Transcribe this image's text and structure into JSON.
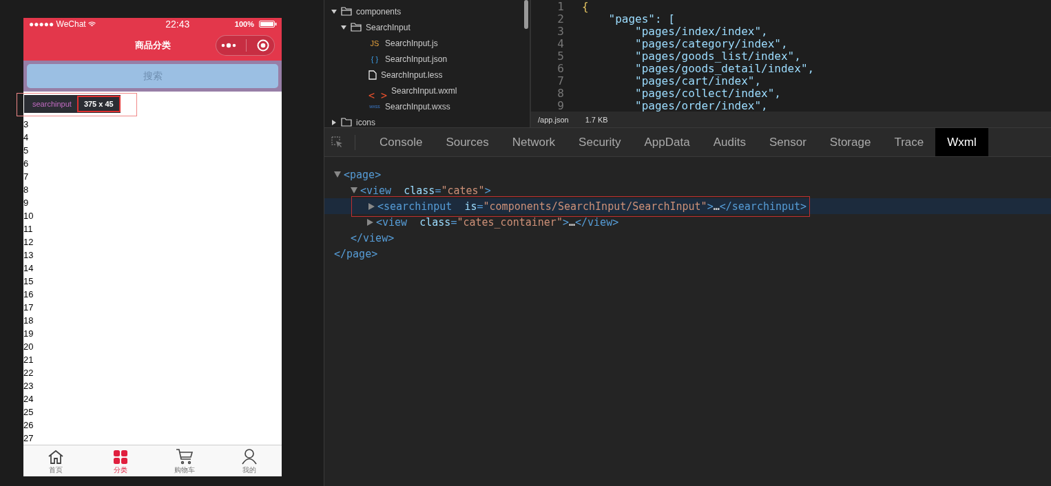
{
  "phone": {
    "status_bar": {
      "carrier": "●●●●● WeChat",
      "time": "22:43",
      "battery": "100%"
    },
    "nav_title": "商品分类",
    "search": {
      "placeholder": "搜索"
    },
    "inspect_tooltip": {
      "tag": "searchinput",
      "size": "375 x 45"
    },
    "list_items": [
      "3",
      "4",
      "5",
      "6",
      "7",
      "8",
      "9",
      "10",
      "11",
      "12",
      "13",
      "14",
      "15",
      "16",
      "17",
      "18",
      "19",
      "20",
      "21",
      "22",
      "23",
      "24",
      "25",
      "26",
      "27"
    ],
    "tab_bar": [
      {
        "kind": "home",
        "label": "首页",
        "selected": false
      },
      {
        "kind": "grid",
        "label": "分类",
        "selected": true
      },
      {
        "kind": "cart",
        "label": "购物车",
        "selected": false
      },
      {
        "kind": "person",
        "label": "我的",
        "selected": false
      }
    ]
  },
  "file_tree": [
    {
      "kind": "folder",
      "name": "components",
      "expanded": true,
      "children": [
        {
          "kind": "folder",
          "name": "SearchInput",
          "expanded": true,
          "children": [
            {
              "kind": "js",
              "badge": "JS",
              "name": "SearchInput.js"
            },
            {
              "kind": "json",
              "badge": "{ }",
              "name": "SearchInput.json"
            },
            {
              "kind": "file",
              "name": "SearchInput.less"
            },
            {
              "kind": "wxml",
              "badge": "< >",
              "name": "SearchInput.wxml"
            },
            {
              "kind": "wxss",
              "badge": "wxss",
              "name": "SearchInput.wxss"
            }
          ]
        }
      ]
    },
    {
      "kind": "folder",
      "name": "icons",
      "expanded": false
    }
  ],
  "editor": {
    "lines": [
      {
        "number": "1",
        "code": "{"
      },
      {
        "number": "2",
        "code": "    \"pages\": ["
      },
      {
        "number": "3",
        "code": "        \"pages/index/index\","
      },
      {
        "number": "4",
        "code": "        \"pages/category/index\","
      },
      {
        "number": "5",
        "code": "        \"pages/goods_list/index\","
      },
      {
        "number": "6",
        "code": "        \"pages/goods_detail/index\","
      },
      {
        "number": "7",
        "code": "        \"pages/cart/index\","
      },
      {
        "number": "8",
        "code": "        \"pages/collect/index\","
      },
      {
        "number": "9",
        "code": "        \"pages/order/index\","
      }
    ],
    "status": {
      "path": "/app.json",
      "size": "1.7 KB"
    }
  },
  "devtools": {
    "tabs": [
      {
        "label": "Console",
        "selected": false
      },
      {
        "label": "Sources",
        "selected": false
      },
      {
        "label": "Network",
        "selected": false
      },
      {
        "label": "Security",
        "selected": false
      },
      {
        "label": "AppData",
        "selected": false
      },
      {
        "label": "Audits",
        "selected": false
      },
      {
        "label": "Sensor",
        "selected": false
      },
      {
        "label": "Storage",
        "selected": false
      },
      {
        "label": "Trace",
        "selected": false
      },
      {
        "label": "Wxml",
        "selected": true
      }
    ],
    "wxml_tree": [
      {
        "expanded": true,
        "selected": false,
        "open": [
          {
            "kind": "tag",
            "text": "<page>"
          }
        ],
        "close": [
          {
            "kind": "tag",
            "text": "</page>"
          }
        ],
        "children": [
          {
            "expanded": true,
            "selected": false,
            "open": [
              {
                "kind": "tag",
                "text": "<view"
              },
              {
                "kind": "attr",
                "text": "  class"
              },
              {
                "kind": "tag",
                "text": "="
              },
              {
                "kind": "value",
                "text": "\"cates\""
              },
              {
                "kind": "tag",
                "text": ">"
              }
            ],
            "close": [
              {
                "kind": "tag",
                "text": "</view>"
              }
            ],
            "children": [
              {
                "expanded": false,
                "selected": true,
                "open": [
                  {
                    "kind": "tag",
                    "text": "<searchinput"
                  },
                  {
                    "kind": "attr",
                    "text": "  is"
                  },
                  {
                    "kind": "tag",
                    "text": "="
                  },
                  {
                    "kind": "value",
                    "text": "\"components/SearchInput/SearchInput\""
                  },
                  {
                    "kind": "tag",
                    "text": ">"
                  },
                  {
                    "kind": "dots",
                    "text": "…"
                  },
                  {
                    "kind": "tag",
                    "text": "</searchinput>"
                  }
                ]
              },
              {
                "expanded": false,
                "selected": false,
                "open": [
                  {
                    "kind": "tag",
                    "text": "<view"
                  },
                  {
                    "kind": "attr",
                    "text": "  class"
                  },
                  {
                    "kind": "tag",
                    "text": "="
                  },
                  {
                    "kind": "value",
                    "text": "\"cates_container\""
                  },
                  {
                    "kind": "tag",
                    "text": ">"
                  },
                  {
                    "kind": "dots",
                    "text": "…"
                  },
                  {
                    "kind": "tag",
                    "text": "</view>"
                  }
                ]
              }
            ]
          }
        ]
      }
    ]
  }
}
